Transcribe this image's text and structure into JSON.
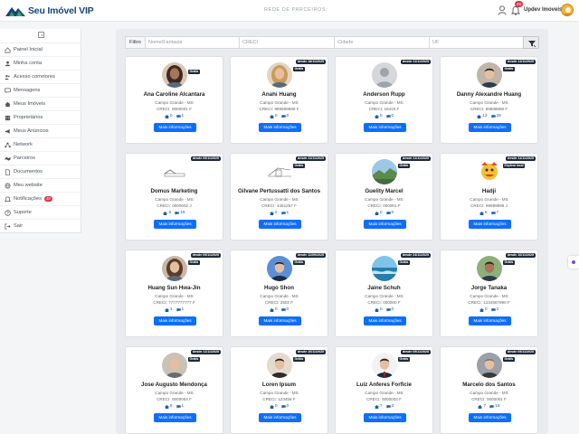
{
  "header": {
    "brand": "Seu Imóvel VIP",
    "page_title": "REDE DE PARCEIROS",
    "notifications_count": "48",
    "username": "Updev Imoveis"
  },
  "sidebar": {
    "items": [
      {
        "label": "Painel Inicial",
        "icon": "home-icon"
      },
      {
        "label": "Minha conta",
        "icon": "user-icon"
      },
      {
        "label": "Acesso corretores",
        "icon": "users-icon"
      },
      {
        "label": "Mensagens",
        "icon": "chat-icon"
      },
      {
        "label": "Meus Imóveis",
        "icon": "house-icon"
      },
      {
        "label": "Proprietários",
        "icon": "building-icon"
      },
      {
        "label": "Meus Anúncios",
        "icon": "megaphone-icon"
      },
      {
        "label": "Network",
        "icon": "network-icon"
      },
      {
        "label": "Parceiros",
        "icon": "handshake-icon"
      },
      {
        "label": "Documentos",
        "icon": "document-icon"
      },
      {
        "label": "Meu website",
        "icon": "globe-icon"
      },
      {
        "label": "Notificações",
        "icon": "bell-icon",
        "badge": "48"
      },
      {
        "label": "Suporte",
        "icon": "question-icon"
      },
      {
        "label": "Sair",
        "icon": "logout-icon"
      }
    ]
  },
  "filters": {
    "label": "Filtro",
    "name_placeholder": "Nome/Fantasia",
    "creci_placeholder": "CRECI",
    "city_placeholder": "Cidade",
    "uf_placeholder": "UF"
  },
  "cards": [
    {
      "name": "Ana Caroline Alcantara",
      "city": "Campo Grande - MS",
      "creci": "CRECI: 0000001 F",
      "properties": "0",
      "messages": "1",
      "since": "",
      "plan": "Grátis",
      "button": "Mais informações",
      "avatar": "woman-dark"
    },
    {
      "name": "Anahi Huang",
      "city": "Campo Grande - MS",
      "creci": "CRECI: 999999999 F",
      "properties": "0",
      "messages": "0",
      "since": "desde 18/11/2025",
      "plan": "Grátis",
      "button": "Mais informações",
      "avatar": "woman-blonde"
    },
    {
      "name": "Anderson Rupp",
      "city": "Campo Grande - MS",
      "creci": "CRECI: 16419 F",
      "properties": "0",
      "messages": "0",
      "since": "desde 11/11/2025",
      "plan": "",
      "button": "Mais informações",
      "avatar": "placeholder"
    },
    {
      "name": "Danny Alexandre Huang",
      "city": "Campo Grande - MS",
      "creci": "CRECI: 88888888 F",
      "properties": "13",
      "messages": "29",
      "since": "desde 11/11/2025",
      "plan": "Grátis",
      "button": "Mais informações",
      "avatar": "man-suit"
    },
    {
      "name": "Domus Marketing",
      "city": "Campo Grande - MS",
      "creci": "CRECI: 0000002 J",
      "properties": "6",
      "messages": "15",
      "since": "desde 09/11/2025",
      "plan": "",
      "button": "Mais informações",
      "avatar": "logo-domus"
    },
    {
      "name": "Gilvane Pertussatti dos Santos",
      "city": "Campo Grande - MS",
      "creci": "CRECI: 4451257 F",
      "properties": "2",
      "messages": "1",
      "since": "desde 11/11/2025",
      "plan": "Grátis",
      "button": "Mais informações",
      "avatar": "logo-building"
    },
    {
      "name": "Guelity Marcel",
      "city": "Campo Grande - MS",
      "creci": "CRECI: 000001 F",
      "properties": "0",
      "messages": "0",
      "since": "desde 11/11/2025",
      "plan": "Grátis",
      "button": "Mais informações",
      "avatar": "landscape"
    },
    {
      "name": "Hadji",
      "city": "Campo Grande - MS",
      "creci": "CRECI: 99999999 J",
      "properties": "6",
      "messages": "7",
      "since": "desde 11/11/2025",
      "plan": "Explora local",
      "button": "Mais informações",
      "avatar": "cartoon"
    },
    {
      "name": "Huang Sun Hwa-Jin",
      "city": "Campo Grande - MS",
      "creci": "CRECI: 7777777777 F",
      "properties": "1",
      "messages": "1",
      "since": "desde 09/11/2025",
      "plan": "Grátis",
      "button": "Mais informações",
      "avatar": "woman-brown"
    },
    {
      "name": "Hugo Shon",
      "city": "Campo Grande - MS",
      "creci": "CRECI: 2502 F",
      "properties": "0",
      "messages": "0",
      "since": "desde 11/09/2025",
      "plan": "Grátis",
      "button": "Mais informações",
      "avatar": "man-blue"
    },
    {
      "name": "Jaine Schuh",
      "city": "Campo Grande - MS",
      "creci": "CRECI: 000000 F",
      "properties": "0",
      "messages": "0",
      "since": "desde 24/11/2025",
      "plan": "Grátis",
      "button": "Mais informações",
      "avatar": "ocean"
    },
    {
      "name": "Jorge Tanaka",
      "city": "Campo Grande - MS",
      "creci": "CRECI: 1234567890 F",
      "properties": "0",
      "messages": "2",
      "since": "desde 10/11/2025",
      "plan": "Grátis",
      "button": "Mais informações",
      "avatar": "man-green"
    },
    {
      "name": "Jose Augusto Mendonça",
      "city": "Campo Grande - MS",
      "creci": "CRECI: 0000004 F",
      "properties": "6",
      "messages": "1",
      "since": "desde 11/11/2025",
      "plan": "Grátis",
      "button": "Mais informações",
      "avatar": "man-bald"
    },
    {
      "name": "Loren Ipsum",
      "city": "Campo Grande - MS",
      "creci": "CRECI: 123456 F",
      "properties": "0",
      "messages": "0",
      "since": "desde 10/11/2025",
      "plan": "Grátis",
      "button": "Mais informações",
      "avatar": "man-beige"
    },
    {
      "name": "Luiz Anferes Forficie",
      "city": "Campo Grande - MS",
      "creci": "CRECI: 0000003 F",
      "properties": "7",
      "messages": "3",
      "since": "desde 09/11/2025",
      "plan": "Grátis",
      "button": "Mais informações",
      "avatar": "man-tie"
    },
    {
      "name": "Marcelo dos Santos",
      "city": "Campo Grande - MS",
      "creci": "CRECI: 0000001 F",
      "properties": "7",
      "messages": "16",
      "since": "desde 09/11/2025",
      "plan": "Grátis",
      "button": "Mais informações",
      "avatar": "man-grey"
    }
  ],
  "colors": {
    "brand": "#16467a",
    "accent": "#0d6efd",
    "badge": "#dc3545",
    "dark_tag": "#1e2a3a"
  }
}
